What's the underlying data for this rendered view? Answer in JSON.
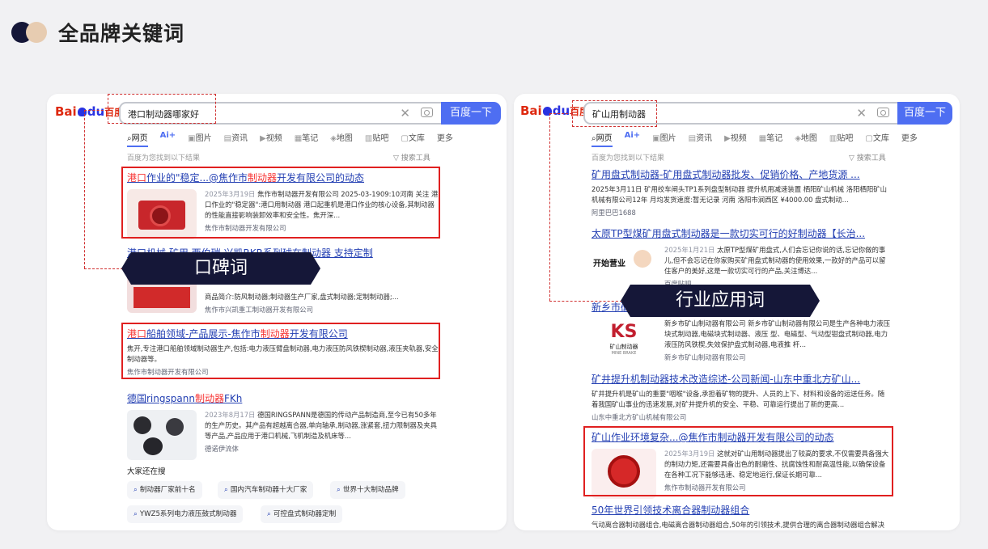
{
  "header": {
    "title": "全品牌关键词"
  },
  "brand": {
    "name_bai": "Bai",
    "name_du": "du",
    "name_cn": "百度"
  },
  "common": {
    "search_button": "百度一下",
    "clear": "✕",
    "result_hint": "百度为您找到以下结果",
    "tools": "▽ 搜索工具"
  },
  "left": {
    "query": "港口制动器哪家好",
    "tabs": [
      "网页",
      "图片",
      "资讯",
      "视频",
      "笔记",
      "地图",
      "贴吧",
      "文库",
      "更多"
    ],
    "results": [
      {
        "title_hl1": "港口",
        "title_mid": "作业的\"稳定...@焦作市",
        "title_hl2": "制动器",
        "title_end": "开发有限公司的动态",
        "date": "2025年3月19日",
        "text": "焦作市制动器开发有限公司 2025-03-1909:10河南 关注 港口作业的\"稳定器\":港口用制动器 港口起重机是港口作业的核心设备,其制动器的性能直接影响装卸效率和安全性。焦开深...",
        "source": "焦作市制动器开发有限公司"
      },
      {
        "title": "港口机械 矿用 西伯瑞 兴凯RKR系列球在制动器 支持定制",
        "text1": "商品简介:防风制动器;制动器生产厂家,盘式制动器;定制制动器;...",
        "source": "焦作市兴凯重工制动器开发有限公司"
      },
      {
        "title_hl1": "港口",
        "title_mid": "船舶领域-产品展示-焦作市",
        "title_hl2": "制动器",
        "title_end": "开发有限公司",
        "text": "焦开,专注港口船舶领域制动器生产,包括:电力液压臂盘制动器,电力液压防风铁楔制动器,液压夹轨器,安全制动器等。",
        "source": "焦作市制动器开发有限公司"
      },
      {
        "title_a": "德国ringspann",
        "title_hl": "制动器",
        "title_b": "FKh",
        "date": "2023年8月17日",
        "text": "德国RINGSPANN是德国的传动产品制造商,至今已有50多年的生产历史。其产品有超越离合器,单向轴承,制动器,涨紧套,扭力限制器及夹具等产品,产品应用于港口机械,飞机制造及机床等...",
        "source": "德诺伊流体"
      }
    ],
    "also_title": "大家还在搜",
    "chips": [
      "制动器厂家前十名",
      "国内汽车制动器十大厂家",
      "世界十大制动品牌",
      "YWZ5系列电力液压鼓式制动器",
      "可控盘式制动器定制"
    ],
    "banner": "口碑词"
  },
  "right": {
    "query": "矿山用制动器",
    "tabs": [
      "网页",
      "图片",
      "资讯",
      "视频",
      "笔记",
      "地图",
      "贴吧",
      "文库",
      "更多"
    ],
    "results": [
      {
        "title": "矿用盘式制动器-矿用盘式制动器批发、促销价格、产地货源 ...",
        "text": "2025年3月11日 矿用绞车闸头TP1系列盘型制动器 提升机用减速装置 栖阳矿山机械 洛阳栖阳矿山机械有限公司12年 月均发货速度:暂无记录 河南 洛阳市涧西区 ¥4000.00 盘式制动...",
        "source": "阿里巴巴1688"
      },
      {
        "title": "太原TP型煤矿用盘式制动器是一款切实可行的好制动器【长治...",
        "date": "2025年1月21日",
        "text": "太原TP型煤矿用盘式,人们会忘记你说的话,忘记你做的事儿,但不会忘记在你家购买矿用盘式制动器的使用效果,一款好的产品可以留住客户的美好,这是一款切实可行的产品,关注博达...",
        "source": "百度贴吧",
        "thumb": "开始营业"
      },
      {
        "title": "新乡市矿山制动器有限公司",
        "text": "新乡市矿山制动器有限公司 新乡市矿山制动器有限公司是生产各种电力液压块式制动器,电磁块式制动器、液压 型、电磁型、气动型钳盘式制动器,电力液压防风铁楔,失效保护盘式制动器,电液推 杆...",
        "source": "新乡市矿山制动器有限公司",
        "thumb": "KS",
        "thumb_sub": "矿山制动器",
        "thumb_en": "MINE BRAKE"
      },
      {
        "title": "矿井提升机制动器技术改造综述-公司新闻-山东中重北方矿山...",
        "text": "矿井提升机是矿山的重要\"咽喉\"设备,承担着矿物的提升、人员的上下、材料和设备的运送任务。随着我国矿山事业的迅速发展,对矿井提升机的安全、平稳、可靠运行提出了新的更高...",
        "source": "山东中重北方矿山机械有限公司"
      },
      {
        "title": "矿山作业环境复杂...@焦作市制动器开发有限公司的动态",
        "date": "2025年3月19日",
        "text": "这就对矿山用制动器提出了较高的要求,不仅需要具备强大的制动力矩,还需要具备出色的耐磨性、抗腐蚀性和耐高温性能,以确保设备在各种工况下能够迅速、稳定地运行,保证长期可靠...",
        "source": "焦作市制动器开发有限公司"
      },
      {
        "title": "50年世界引领技术离合器制动器组合",
        "text": "气动离合器制动器组合,电磁离合器制动器组合,50年的引领技术,提供合理的离合器制动器组合解决"
      }
    ],
    "banner": "行业应用词"
  },
  "colors": {
    "accent": "#4e6ef2",
    "link": "#2440b3",
    "highlight": "#f73131",
    "banner": "#151738",
    "frame": "#e02020"
  }
}
